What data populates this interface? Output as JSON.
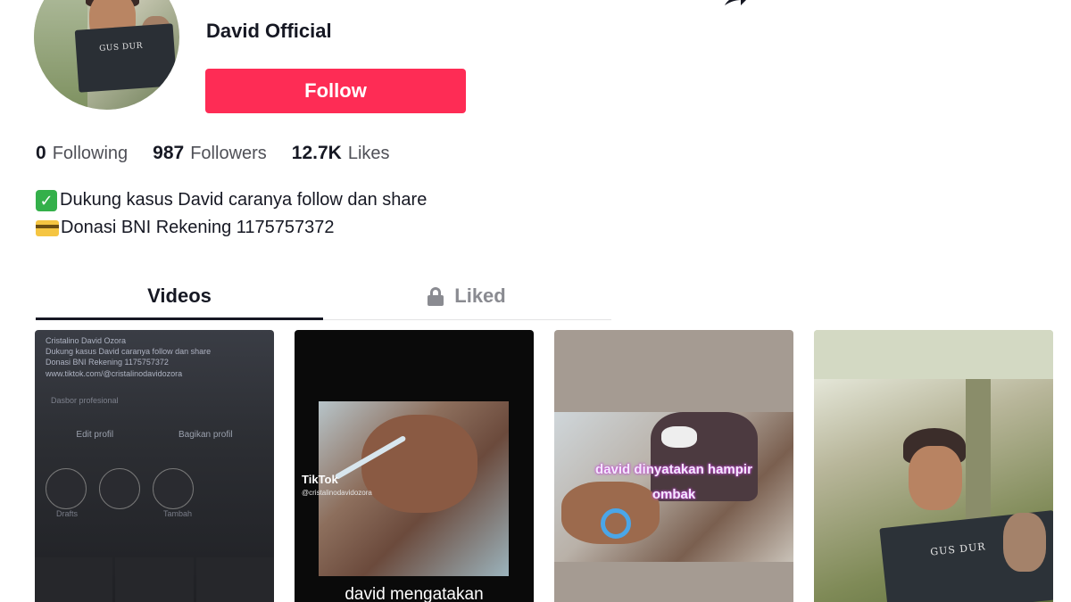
{
  "profile": {
    "username": "David Official",
    "follow_label": "Follow"
  },
  "stats": [
    {
      "value": "0",
      "label": "Following"
    },
    {
      "value": "987",
      "label": "Followers"
    },
    {
      "value": "12.7K",
      "label": "Likes"
    }
  ],
  "bio": {
    "line1": "Dukung kasus David caranya follow dan share",
    "line2": "Donasi BNI Rekening 1175757372"
  },
  "tabs": {
    "videos": "Videos",
    "liked": "Liked"
  },
  "videos": [
    {
      "lines": [
        "Cristalino David Ozora",
        "Dukung kasus David caranya follow dan share",
        "Donasi BNI Rekening 1175757372",
        "www.tiktok.com/@cristalinodavidozora",
        "Dasbor profesional",
        "Edit profil",
        "Bagikan profil",
        "Tambah",
        "Drafts"
      ]
    },
    {
      "watermark": "TikTok",
      "handle": "@cristalinodavidozora",
      "caption": "david mengatakan"
    },
    {
      "caption_line1": "david dinyatakan hampir",
      "caption_line2": "ombak"
    },
    {
      "book_title": "GUS DUR"
    }
  ],
  "avatar": {
    "book_title": "GUS DUR"
  },
  "colors": {
    "accent": "#fe2c55",
    "text": "#161823",
    "muted": "#8a8b91"
  }
}
